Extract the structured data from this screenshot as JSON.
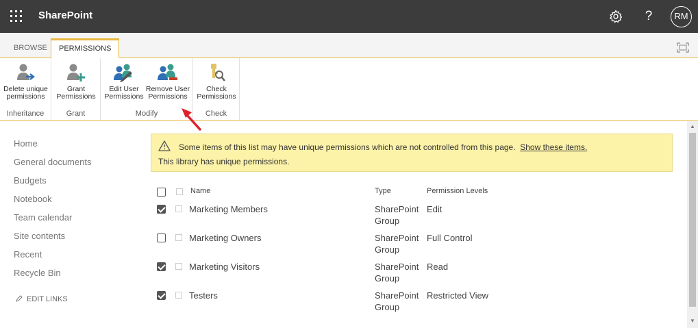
{
  "app": {
    "title": "SharePoint",
    "avatar_initials": "RM"
  },
  "icons": {
    "waffle": "app-launcher-icon",
    "settings": "gear-icon",
    "help": "question-icon",
    "focus": "focus-mode-icon",
    "pencil": "pencil-icon",
    "warning": "warning-icon"
  },
  "ribbon": {
    "tabs": [
      {
        "label": "BROWSE"
      },
      {
        "label": "PERMISSIONS"
      }
    ],
    "groups": [
      {
        "label": "Inheritance",
        "buttons": [
          {
            "line1": "Delete unique",
            "line2": "permissions",
            "icon": "delete-permissions-icon"
          }
        ]
      },
      {
        "label": "Grant",
        "buttons": [
          {
            "line1": "Grant",
            "line2": "Permissions",
            "icon": "grant-permissions-icon"
          }
        ]
      },
      {
        "label": "Modify",
        "buttons": [
          {
            "line1": "Edit User",
            "line2": "Permissions",
            "icon": "edit-user-icon"
          },
          {
            "line1": "Remove User",
            "line2": "Permissions",
            "icon": "remove-user-icon"
          }
        ]
      },
      {
        "label": "Check",
        "buttons": [
          {
            "line1": "Check",
            "line2": "Permissions",
            "icon": "check-permissions-icon"
          }
        ]
      }
    ]
  },
  "leftnav": {
    "items": [
      "Home",
      "General documents",
      "Budgets",
      "Notebook",
      "Team calendar",
      "Site contents",
      "Recent",
      "Recycle Bin"
    ],
    "edit_links": "EDIT LINKS"
  },
  "notice": {
    "line1": "Some items of this list may have unique permissions which are not controlled from this page.",
    "link": "Show these items.",
    "line2": "This library has unique permissions."
  },
  "table": {
    "headers": {
      "name": "Name",
      "type": "Type",
      "levels": "Permission Levels"
    },
    "rows": [
      {
        "name": "Marketing Members",
        "type_line1": "SharePoint",
        "type_line2": "Group",
        "level": "Edit",
        "checked": true
      },
      {
        "name": "Marketing Owners",
        "type_line1": "SharePoint",
        "type_line2": "Group",
        "level": "Full Control",
        "checked": false
      },
      {
        "name": "Marketing Visitors",
        "type_line1": "SharePoint",
        "type_line2": "Group",
        "level": "Read",
        "checked": true
      },
      {
        "name": "Testers",
        "type_line1": "SharePoint",
        "type_line2": "Group",
        "level": "Restricted View",
        "checked": true
      }
    ]
  },
  "colors": {
    "suitebar": "#3c3c3c",
    "accent": "#e8b83e",
    "notice_bg": "#fcf2a8",
    "annotation_arrow": "#e0202a",
    "icon_teal": "#3a9b8f",
    "icon_red": "#c8402a"
  }
}
